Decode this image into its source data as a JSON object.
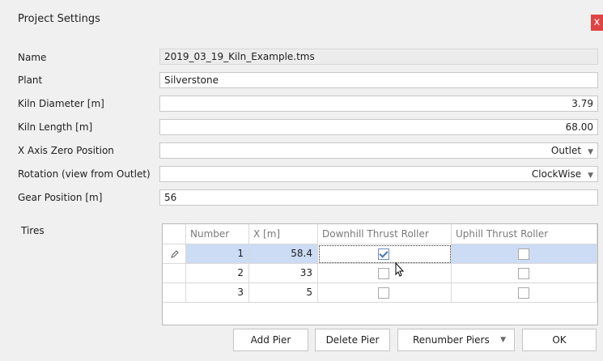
{
  "window": {
    "title": "Project Settings",
    "close_glyph": "x"
  },
  "fields": {
    "name": {
      "label": "Name",
      "value": "2019_03_19_Kiln_Example.tms"
    },
    "plant": {
      "label": "Plant",
      "value": "Silverstone"
    },
    "kiln_diameter": {
      "label": "Kiln Diameter [m]",
      "value": "3.79"
    },
    "kiln_length": {
      "label": "Kiln Length [m]",
      "value": "68.00"
    },
    "x_axis_zero": {
      "label": "X Axis Zero Position",
      "value": "Outlet",
      "options_visible": [
        "Outlet"
      ]
    },
    "rotation": {
      "label": "Rotation (view from Outlet)",
      "value": "ClockWise",
      "options_visible": [
        "ClockWise"
      ]
    },
    "gear_position": {
      "label": "Gear Position [m]",
      "value": "56"
    }
  },
  "tires": {
    "label": "Tires",
    "columns": [
      "Number",
      "X [m]",
      "Downhill Thrust Roller",
      "Uphill Thrust Roller"
    ],
    "rows": [
      {
        "number": "1",
        "x": "58.4",
        "downhill": true,
        "uphill": false,
        "selected": true
      },
      {
        "number": "2",
        "x": "33",
        "downhill": false,
        "uphill": false,
        "selected": false
      },
      {
        "number": "3",
        "x": "5",
        "downhill": false,
        "uphill": false,
        "selected": false
      }
    ]
  },
  "buttons": {
    "add_pier": "Add Pier",
    "delete_pier": "Delete Pier",
    "renumber_piers": "Renumber Piers",
    "ok": "OK"
  },
  "icons": [
    "close-icon",
    "edit-pencil-icon",
    "dropdown-caret-icon",
    "checkmark-icon",
    "mouse-cursor-icon"
  ]
}
